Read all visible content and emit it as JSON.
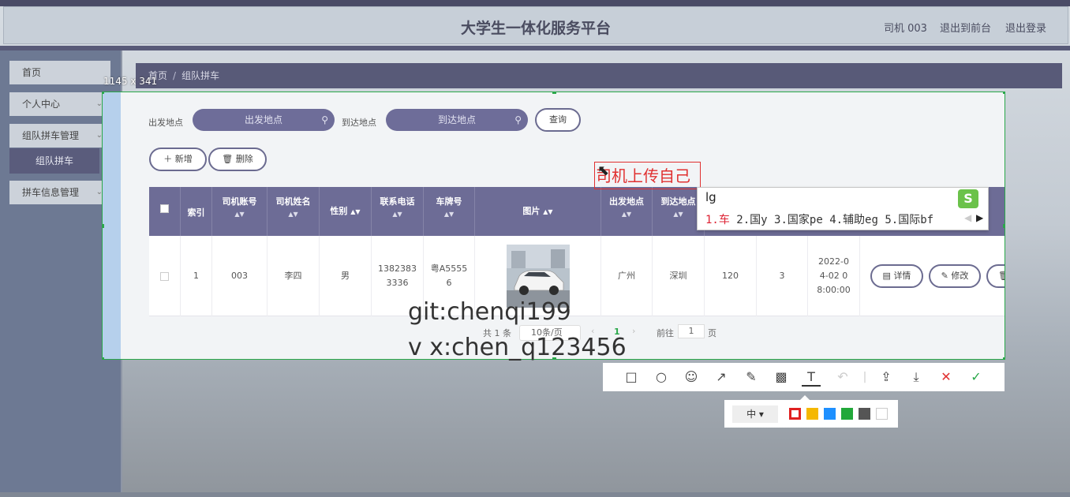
{
  "header": {
    "title": "大学生一体化服务平台",
    "user": "司机 003",
    "to_front": "退出到前台",
    "logout": "退出登录"
  },
  "sidebar": {
    "items": [
      {
        "label": "首页"
      },
      {
        "label": "个人中心"
      },
      {
        "label": "组队拼车管理"
      },
      {
        "label": "拼车信息管理"
      }
    ],
    "sub_item": "组队拼车"
  },
  "breadcrumb": {
    "home": "首页",
    "sep": "/",
    "current": "组队拼车"
  },
  "capture": {
    "size_label": "1145 x 341"
  },
  "search": {
    "from_label": "出发地点",
    "from_placeholder": "出发地点",
    "to_label": "到达地点",
    "to_placeholder": "到达地点",
    "query_button": "查询"
  },
  "actions": {
    "add": "新增",
    "delete": "删除"
  },
  "table": {
    "headers": [
      "索引",
      "司机账号",
      "司机姓名",
      "性别",
      "联系电话",
      "车牌号",
      "图片",
      "出发地点",
      "到达地点"
    ],
    "row": {
      "index": "1",
      "account": "003",
      "name": "李四",
      "gender": "男",
      "phone": "13823833336",
      "plate": "粤A55556",
      "from": "广州",
      "to": "深圳",
      "col_price": "120",
      "col_seats": "3",
      "time": "2022-04-02 08:00:00"
    },
    "row_actions": {
      "detail": "详情",
      "edit": "修改",
      "delete": "删除"
    }
  },
  "pager": {
    "total": "共 1 条",
    "page_size": "10条/页",
    "page": "1",
    "goto_label": "前往",
    "goto_value": "1",
    "page_unit": "页"
  },
  "ime": {
    "composition": "lg",
    "candidates": [
      "1.车",
      "2.国y",
      "3.国家pe",
      "4.辅助eg",
      "5.国际bf"
    ]
  },
  "annotation": {
    "text": "司机上传自己"
  },
  "watermark": {
    "line1": "git:chenqi199",
    "line2": "v x:chen_q123456"
  },
  "palette": {
    "size_label": "中",
    "colors": [
      "#e02020",
      "#f5b800",
      "#1e90ff",
      "#22a83a",
      "#555555",
      "#ffffff"
    ]
  }
}
